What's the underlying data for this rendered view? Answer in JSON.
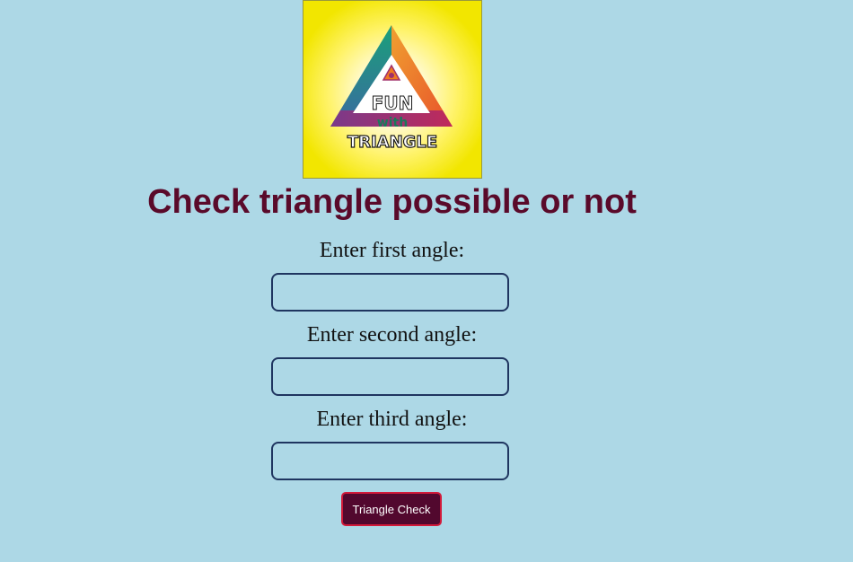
{
  "logo": {
    "line1": "FUN",
    "line2": "with",
    "line3": "TRIANGLE",
    "colors": {
      "background": "#f2e600",
      "triangle_left": "#1a9a7a",
      "triangle_right": "#f07a20",
      "triangle_base": "#a0306a"
    }
  },
  "page": {
    "title": "Check triangle possible or not"
  },
  "form": {
    "first_label": "Enter first angle:",
    "first_value": "",
    "second_label": "Enter second angle:",
    "second_value": "",
    "third_label": "Enter third angle:",
    "third_value": "",
    "submit_label": "Triangle Check"
  },
  "colors": {
    "page_background": "#add8e6",
    "title": "#5a0a2a",
    "button_background": "#52082e",
    "button_border": "#d21a3a",
    "input_border": "#1f3560"
  }
}
